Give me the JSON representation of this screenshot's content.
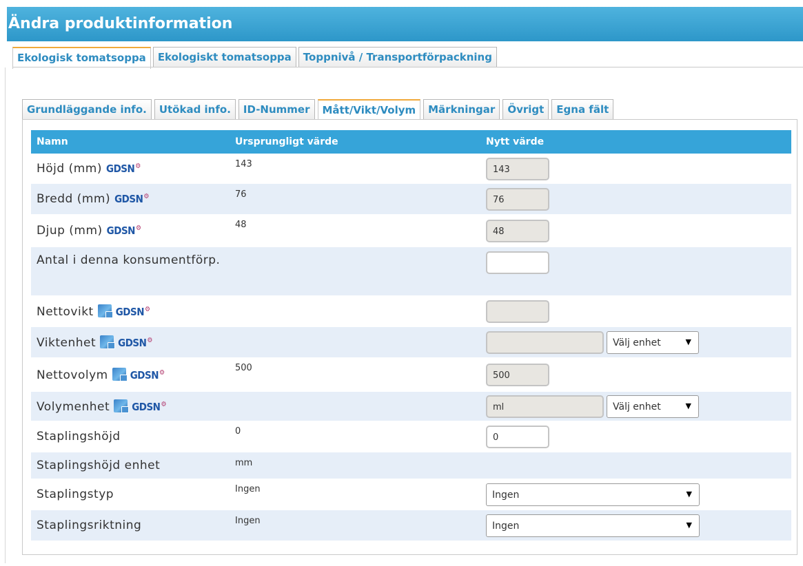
{
  "title": "Ändra produktinformation",
  "outer_tabs": [
    "Ekologisk tomatsoppa",
    "Ekologiskt tomatsoppa",
    "Toppnivå / Transportförpackning"
  ],
  "inner_tabs": [
    "Grundläggande info.",
    "Utökad info.",
    "ID-Nummer",
    "Mått/Vikt/Volym",
    "Märkningar",
    "Övrigt",
    "Egna fält"
  ],
  "table": {
    "headers": [
      "Namn",
      "Ursprungligt värde",
      "Nytt värde"
    ],
    "rows": [
      {
        "name": "Höjd (mm)",
        "orig": "143",
        "value": "143"
      },
      {
        "name": "Bredd (mm)",
        "orig": "76",
        "value": "76"
      },
      {
        "name": "Djup (mm)",
        "orig": "48",
        "value": "48"
      },
      {
        "name": "Antal i denna konsumentförp.",
        "orig": "",
        "value": ""
      },
      {
        "name": "Nettovikt",
        "orig": "",
        "value": ""
      },
      {
        "name": "Viktenhet",
        "orig": "",
        "value": "",
        "select": "Välj enhet"
      },
      {
        "name": "Nettovolym",
        "orig": "500",
        "value": "500"
      },
      {
        "name": "Volymenhet",
        "orig": "",
        "value": "ml",
        "select": "Välj enhet"
      },
      {
        "name": "Staplingshöjd",
        "orig": "0",
        "value": "0"
      },
      {
        "name": "Staplingshöjd enhet",
        "orig": "mm"
      },
      {
        "name": "Staplingstyp",
        "orig": "Ingen",
        "select": "Ingen"
      },
      {
        "name": "Staplingsriktning",
        "orig": "Ingen",
        "select": "Ingen"
      }
    ]
  },
  "gdsn_label": "GDSN",
  "gdsn_mark": "⚙",
  "dropdown_arrow": "▼",
  "icons": {
    "gdsn": "gdsn-logo-icon",
    "eu": "eu-flag-icon"
  },
  "colors": {
    "header_blue": "#36a4d9",
    "tab_text": "#2e8cc0",
    "active_tab": "#f0a93a",
    "row_alt": "#e6eef8"
  }
}
